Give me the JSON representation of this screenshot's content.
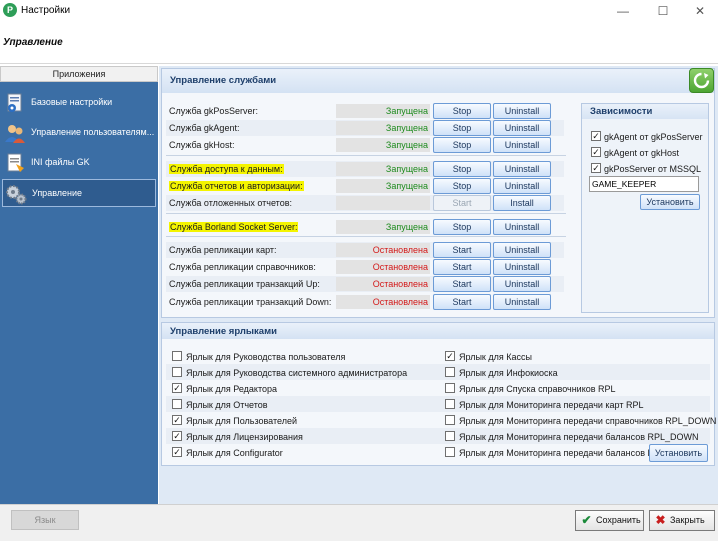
{
  "window": {
    "title": "Настройки",
    "icon_letter": "P",
    "minimize_glyph": "—",
    "maximize_glyph": "☐",
    "close_glyph": "✕"
  },
  "page_title": "Управление",
  "sidebar": {
    "header": "Приложения",
    "items": [
      {
        "label": "Базовые настройки",
        "icon": "settings-document-icon",
        "active": false
      },
      {
        "label": "Управление пользователям...",
        "icon": "users-icon",
        "active": false
      },
      {
        "label": "INI файлы GK",
        "icon": "ini-file-icon",
        "active": false
      },
      {
        "label": "Управление",
        "icon": "gears-icon",
        "active": true
      }
    ]
  },
  "services": {
    "title": "Управление службами",
    "rows": [
      {
        "name": "Служба gkPosServer:",
        "status": "Запущена",
        "state": "running",
        "primary": "Stop",
        "secondary": "Uninstall",
        "highlight": false
      },
      {
        "name": "Служба gkAgent:",
        "status": "Запущена",
        "state": "running",
        "primary": "Stop",
        "secondary": "Uninstall",
        "highlight": false
      },
      {
        "name": "Служба gkHost:",
        "status": "Запущена",
        "state": "running",
        "primary": "Stop",
        "secondary": "Uninstall",
        "highlight": false
      },
      {
        "name": "Служба доступа к данным:",
        "status": "Запущена",
        "state": "running",
        "primary": "Stop",
        "secondary": "Uninstall",
        "highlight": true
      },
      {
        "name": "Служба отчетов и авторизации:",
        "status": "Запущена",
        "state": "running",
        "primary": "Stop",
        "secondary": "Uninstall",
        "highlight": true
      },
      {
        "name": "Служба отложенных отчетов:",
        "status": "",
        "state": "none",
        "primary": "Start",
        "secondary": "Install",
        "highlight": false,
        "primary_disabled": true
      },
      {
        "name": "Служба Borland Socket Server:",
        "status": "Запущена",
        "state": "running",
        "primary": "Stop",
        "secondary": "Uninstall",
        "highlight": true
      },
      {
        "name": "Служба репликации карт:",
        "status": "Остановлена",
        "state": "stopped",
        "primary": "Start",
        "secondary": "Uninstall",
        "highlight": false
      },
      {
        "name": "Служба репликации справочников:",
        "status": "Остановлена",
        "state": "stopped",
        "primary": "Start",
        "secondary": "Uninstall",
        "highlight": false
      },
      {
        "name": "Служба репликации транзакций Up:",
        "status": "Остановлена",
        "state": "stopped",
        "primary": "Start",
        "secondary": "Uninstall",
        "highlight": false
      },
      {
        "name": "Служба репликации транзакций Down:",
        "status": "Остановлена",
        "state": "stopped",
        "primary": "Start",
        "secondary": "Uninstall",
        "highlight": false
      }
    ]
  },
  "dependencies": {
    "title": "Зависимости",
    "items": [
      {
        "label": "gkAgent от gkPosServer",
        "checked": true
      },
      {
        "label": "gkAgent от gkHost",
        "checked": true
      },
      {
        "label": "gkPosServer от MSSQL",
        "checked": true
      }
    ],
    "input_value": "GAME_KEEPER",
    "install_label": "Установить"
  },
  "shortcuts": {
    "title": "Управление ярлыками",
    "left": [
      {
        "label": "Ярлык для Руководства пользователя",
        "checked": false
      },
      {
        "label": "Ярлык для Руководства системного администратора",
        "checked": false
      },
      {
        "label": "Ярлык для Редактора",
        "checked": true
      },
      {
        "label": "Ярлык для Отчетов",
        "checked": false
      },
      {
        "label": "Ярлык для Пользователей",
        "checked": true
      },
      {
        "label": "Ярлык для Лицензирования",
        "checked": true
      },
      {
        "label": "Ярлык для Configurator",
        "checked": true
      }
    ],
    "right": [
      {
        "label": "Ярлык для Кассы",
        "checked": true
      },
      {
        "label": "Ярлык для Инфокиоска",
        "checked": false
      },
      {
        "label": "Ярлык для Спуска справочников RPL",
        "checked": false
      },
      {
        "label": "Ярлык для Мониторинга передачи карт RPL",
        "checked": false
      },
      {
        "label": "Ярлык для Мониторинга передачи справочников RPL_DOWN",
        "checked": false
      },
      {
        "label": "Ярлык для Мониторинга передачи балансов RPL_DOWN",
        "checked": false
      },
      {
        "label": "Ярлык для Мониторинга передачи балансов R",
        "checked": false
      }
    ],
    "install_label": "Установить"
  },
  "footer": {
    "language_label": "Язык",
    "save_label": "Сохранить",
    "close_label": "Закрыть"
  },
  "colors": {
    "sidebar": "#3b6ea5",
    "running": "#1f8b1f",
    "stopped": "#d31a1a",
    "highlight": "#f4f400",
    "save_icon": "#1b8a3a",
    "close_icon": "#c81e1e"
  }
}
